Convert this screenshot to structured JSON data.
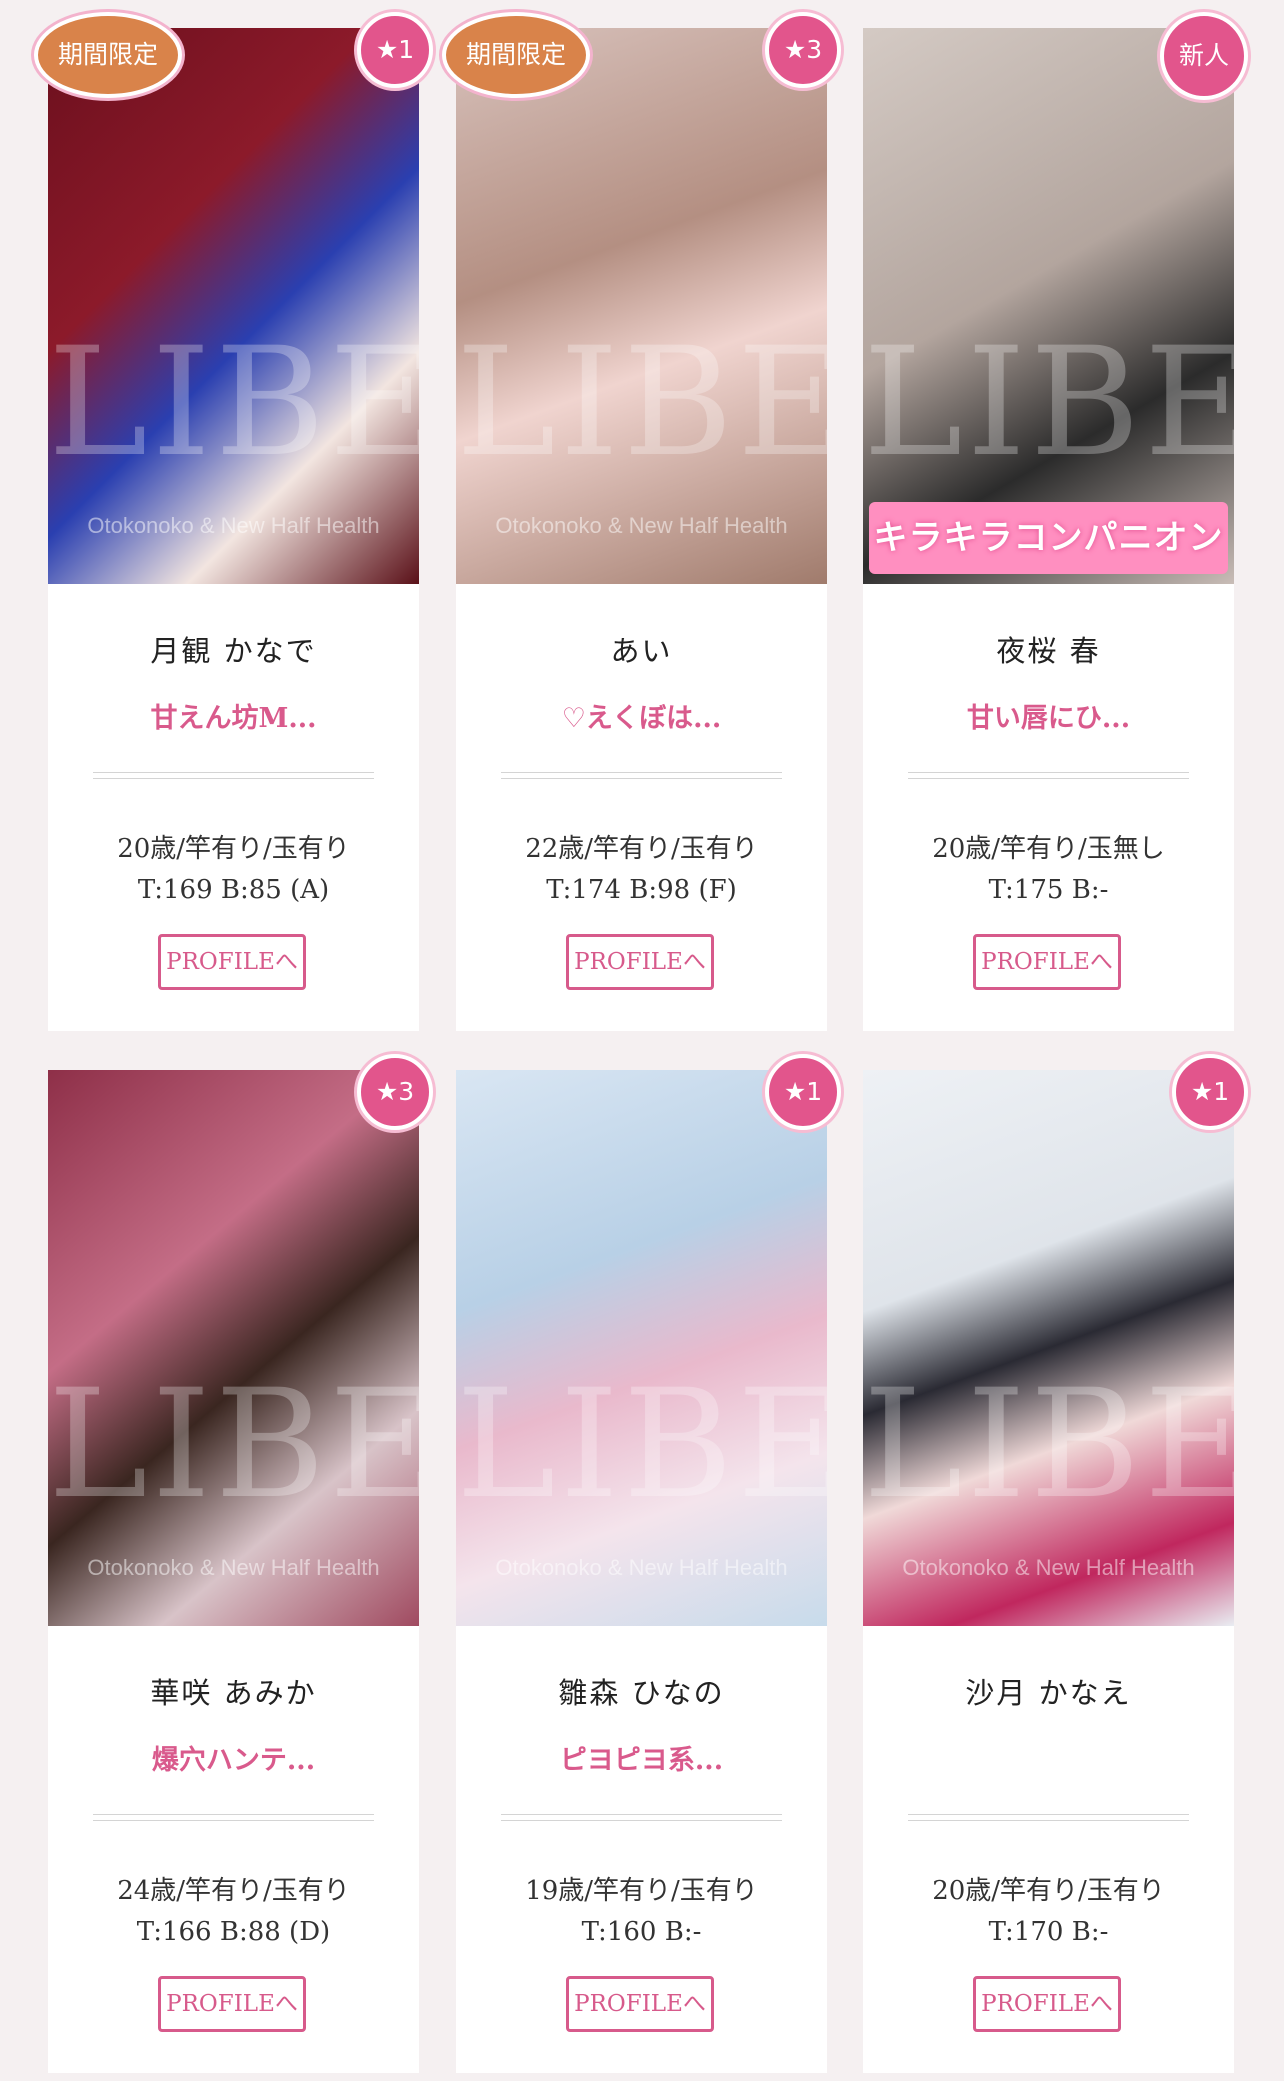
{
  "cards": [
    {
      "badge_left": "期間限定",
      "badge_right": "★1",
      "name": "月観 かなで",
      "catch": "甘えん坊M...",
      "spec1": "20歳/竿有り/玉有り",
      "spec2": "T:169 B:85 (A)",
      "button": "PROFILEへ",
      "watermark": "LIBE",
      "watermark_sub": "Otokonoko & New Half Health",
      "photo_colors": [
        "#7a1420",
        "#2a3fb0"
      ]
    },
    {
      "badge_left": "期間限定",
      "badge_right": "★3",
      "name": "あい",
      "catch": "♡えくぼは...",
      "spec1": "22歳/竿有り/玉有り",
      "spec2": "T:174 B:98 (F)",
      "button": "PROFILEへ",
      "watermark": "LIBE",
      "watermark_sub": "Otokonoko & New Half Health",
      "photo_colors": [
        "#c9a59b",
        "#8a6a5e"
      ]
    },
    {
      "badge_right": "新人",
      "name": "夜桜 春",
      "catch": "甘い唇にひ...",
      "spec1": "20歳/竿有り/玉無し",
      "spec2": "T:175 B:-",
      "button": "PROFILEへ",
      "banner": "キラキラコンパニオン",
      "watermark": "LIBE",
      "photo_colors": [
        "#bfb3ad",
        "#9c8f89"
      ]
    },
    {
      "badge_right": "★3",
      "name": "華咲 あみか",
      "catch": "爆穴ハンテ...",
      "spec1": "24歳/竿有り/玉有り",
      "spec2": "T:166 B:88 (D)",
      "button": "PROFILEへ",
      "watermark": "LIBE",
      "watermark_sub": "Otokonoko & New Half Health",
      "photo_colors": [
        "#a8485e",
        "#d9a5a8"
      ]
    },
    {
      "badge_right": "★1",
      "name": "雛森 ひなの",
      "catch": "ピヨピヨ系...",
      "spec1": "19歳/竿有り/玉有り",
      "spec2": "T:160 B:-",
      "button": "PROFILEへ",
      "watermark": "LIBE",
      "watermark_sub": "Otokonoko & New Half Health",
      "photo_colors": [
        "#cfe0f0",
        "#e8c8d8"
      ]
    },
    {
      "badge_right": "★1",
      "name": "沙月 かなえ",
      "catch": "",
      "spec1": "20歳/竿有り/玉有り",
      "spec2": "T:170 B:-",
      "button": "PROFILEへ",
      "watermark": "LIBE",
      "watermark_sub": "Otokonoko & New Half Health",
      "photo_colors": [
        "#e9edf2",
        "#c0275e"
      ]
    }
  ]
}
